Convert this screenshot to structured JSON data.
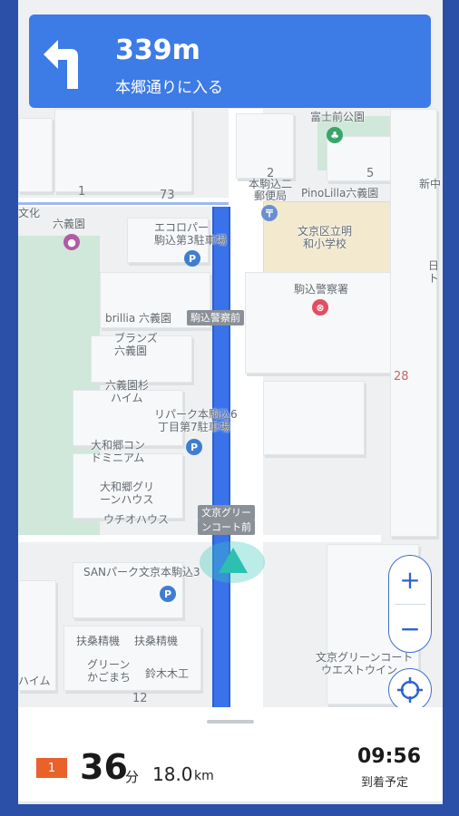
{
  "banner": {
    "distance": "339m",
    "instruction": "本郷通りに入る",
    "turn_icon": "turn-left-arrow-icon"
  },
  "map": {
    "labels": {
      "fujimae_park": "富士前公園",
      "komagome_post_1": "本駒込二",
      "komagome_post_2": "郵便局",
      "pinolilla": "PinoLilla六義園",
      "ecolo_1": "エコロパー",
      "ecolo_2": "駒込第3駐車場",
      "rikugien": "六義園",
      "bunkyo_school_1": "文京区立明",
      "bunkyo_school_2": "和小学校",
      "police": "駒込警察署",
      "brillia": "brillia 六義園",
      "police_front": "駒込警察前",
      "blands_1": "ブランズ",
      "blands_2": "六義園",
      "rikugien_sugi_1": "六義園杉",
      "rikugien_sugi_2": "ハイム",
      "repark_1": "リパーク本駒込6",
      "repark_2": "丁目第7駐車場",
      "yamato_1": "大和郷コン",
      "yamato_2": "ドミニアム",
      "yamato_green_1": "大和郷グリ",
      "yamato_green_2": "ーンハウス",
      "uchio": "ウチオハウス",
      "bunkyo_green_1": "文京グリー",
      "bunkyo_green_2": "ンコート前",
      "san_park": "SANパーク文京本駒込3",
      "fusou_1": "扶桑精機",
      "fusou_2": "扶桑精機",
      "green_kago_1": "グリーン",
      "green_kago_2": "かごまち",
      "suzuki": "鈴木木工",
      "haimu": "ハイム",
      "bunkyo_court_1": "文京グリーンコート",
      "bunkyo_court_2": "ウエストウイン",
      "bunka": "文化",
      "shin": "新中",
      "nichi_1": "日",
      "nichi_2": "ト"
    },
    "numbers": {
      "n73": "73",
      "n1": "1",
      "n5": "5",
      "n2": "2",
      "n28": "28",
      "n12": "12"
    }
  },
  "controls": {
    "zoom_in": "+",
    "zoom_out": "−",
    "locate_icon": "crosshair-icon"
  },
  "trip": {
    "badge": "1",
    "duration": "36",
    "duration_unit": "分",
    "distance": "18.0",
    "distance_unit": "km",
    "eta": "09:56",
    "eta_label": "到着予定"
  }
}
